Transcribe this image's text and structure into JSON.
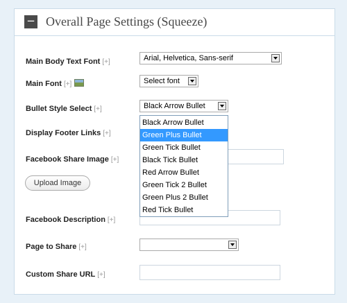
{
  "panel": {
    "collapse_label": "−",
    "title": "Overall Page Settings (Squeeze)"
  },
  "help_tag": "[+]",
  "fields": {
    "main_body_font": {
      "label": "Main Body Text Font",
      "value": "Arial, Helvetica, Sans-serif"
    },
    "main_font": {
      "label": "Main Font",
      "value": "Select font",
      "icon": "image-icon"
    },
    "bullet_style": {
      "label": "Bullet Style Select",
      "value": "Black Arrow Bullet"
    },
    "display_footer_links": {
      "label": "Display Footer Links"
    },
    "facebook_share_image": {
      "label": "Facebook Share Image",
      "upload_label": "Upload Image"
    },
    "facebook_description": {
      "label": "Facebook Description"
    },
    "page_to_share": {
      "label": "Page to Share",
      "value": ""
    },
    "custom_share_url": {
      "label": "Custom Share URL"
    }
  },
  "bullet_options": [
    "Black Arrow Bullet",
    "Green Plus Bullet",
    "Green Tick Bullet",
    "Black Tick Bullet",
    "Red Arrow Bullet",
    "Green Tick 2 Bullet",
    "Green Plus 2 Bullet",
    "Red Tick Bullet"
  ],
  "highlighted_option": "Green Plus Bullet",
  "colors": {
    "page_bg": "#e8f1f8",
    "highlight": "#3399ff",
    "panel_border": "#c9dbe8"
  }
}
